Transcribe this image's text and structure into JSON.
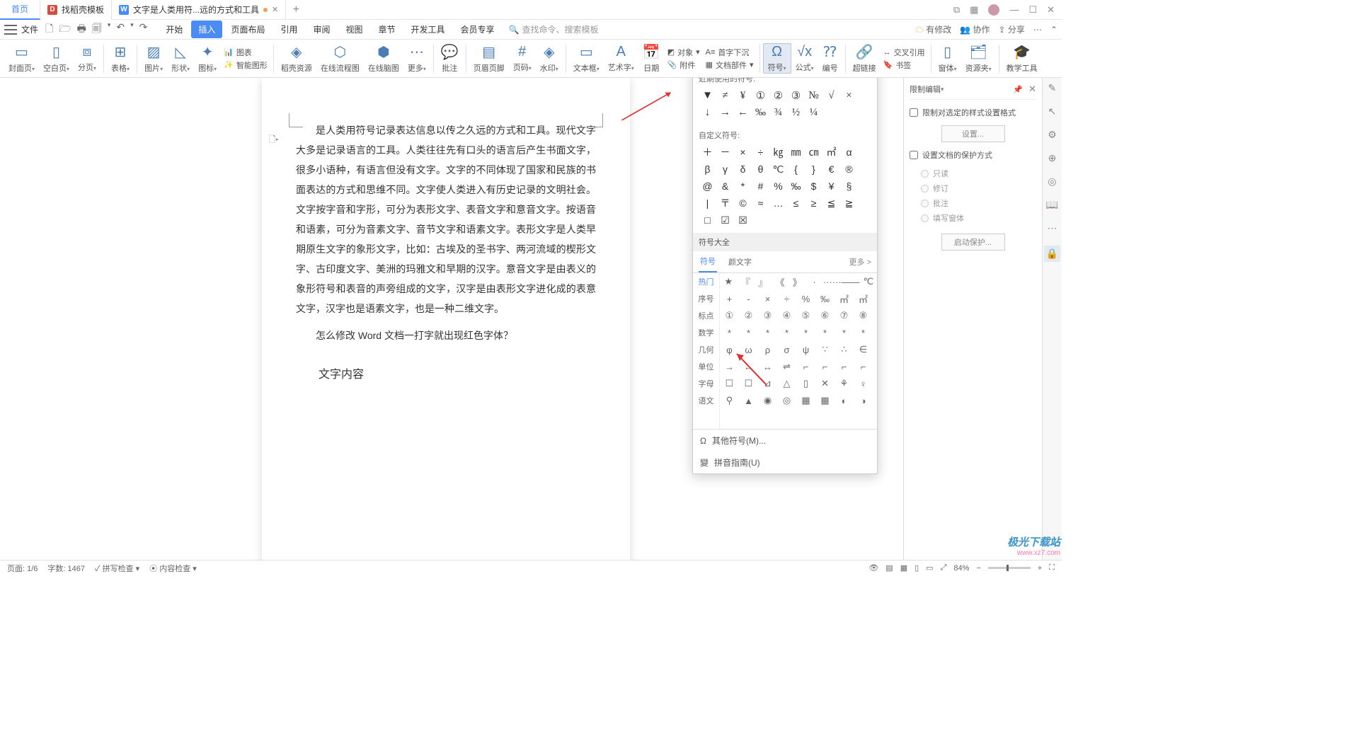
{
  "title_bar": {
    "tabs": [
      {
        "label": "首页"
      },
      {
        "label": "找稻壳模板"
      },
      {
        "label": "文字是人类用符...远的方式和工具"
      }
    ]
  },
  "menu": {
    "file": "文件",
    "tabs": [
      "开始",
      "插入",
      "页面布局",
      "引用",
      "审阅",
      "视图",
      "章节",
      "开发工具",
      "会员专享"
    ],
    "search_placeholder": "查找命令、搜索模板",
    "right": {
      "unsaved": "有修改",
      "collab": "协作",
      "share": "分享"
    }
  },
  "ribbon": {
    "items": [
      "封面页",
      "空白页",
      "分页",
      "表格",
      "图片",
      "形状",
      "图标",
      "智能图形",
      "稻壳资源",
      "在线流程图",
      "在线脑图",
      "更多",
      "批注",
      "页眉页脚",
      "页码",
      "水印",
      "文本框",
      "艺术字",
      "日期",
      "附件",
      "文档部件",
      "符号",
      "公式",
      "编号",
      "超链接",
      "书签",
      "窗体",
      "资源夹",
      "教学工具"
    ],
    "smart_label": "图表",
    "cross_ref": "交叉引用",
    "first_drop": "首字下沉",
    "attachment": "对象"
  },
  "document": {
    "p1": "是人类用符号记录表达信息以传之久远的方式和工具。现代文字大多是记录语言的工具。人类往往先有口头的语言后产生书面文字，很多小语种，有语言但没有文字。文字的不同体现了国家和民族的书面表达的方式和思维不同。文字使人类进入有历史记录的文明社会。文字按字音和字形，可分为表形文字、表音文字和意音文字。按语音和语素，可分为音素文字、音节文字和语素文字。表形文字是人类早期原生文字的象形文字，比如：古埃及的圣书字、两河流域的楔形文字、古印度文字、美洲的玛雅文和早期的汉字。意音文字是由表义的象形符号和表音的声旁组成的文字，汉字是由表形文字进化成的表意文字，汉字也是语素文字，也是一种二维文字。",
    "p2": "怎么修改 Word 文档一打字就出现红色字体？",
    "h2": "文字内容"
  },
  "symbol_panel": {
    "recent_label": "近期使用的符号:",
    "recent": [
      "▼",
      "≠",
      "¥",
      "①",
      "②",
      "③",
      "№",
      "√",
      "×",
      "↓",
      "→",
      "←",
      "‰",
      "¾",
      "½",
      "¼"
    ],
    "custom_label": "自定义符号:",
    "custom": [
      "＋",
      "－",
      "×",
      "÷",
      "㎏",
      "㎜",
      "㎝",
      "㎡",
      "α",
      "β",
      "γ",
      "δ",
      "θ",
      "℃",
      "{",
      "}",
      "€",
      "®",
      "@",
      "&",
      "*",
      "#",
      "%",
      "‰",
      "$",
      "¥",
      "§",
      "|",
      "〒",
      "©",
      "≈",
      "…",
      "≤",
      "≥",
      "≦",
      "≧",
      "□",
      "☑",
      "☒"
    ],
    "all_label": "符号大全",
    "tab1": "符号",
    "tab2": "颜文字",
    "more": "更多 >",
    "cats": [
      "热门",
      "序号",
      "标点",
      "数学",
      "几何",
      "单位",
      "字母",
      "语文"
    ],
    "grid": [
      [
        "★",
        "『",
        "』",
        "《",
        "》",
        "·",
        "······",
        "——",
        "℃"
      ],
      [
        "+",
        "-",
        "×",
        "÷",
        "%",
        "‰",
        "㎡",
        "㎡"
      ],
      [
        "①",
        "②",
        "③",
        "④",
        "⑤",
        "⑥",
        "⑦",
        "⑧"
      ],
      [
        "*",
        "*",
        "*",
        "*",
        "*",
        "*",
        "*",
        "*"
      ],
      [
        "φ",
        "ω",
        "ρ",
        "σ",
        "ψ",
        "∵",
        "∴",
        "∈"
      ],
      [
        "→",
        "←",
        "↔",
        "⇌",
        "⌐",
        "⌐",
        "⌐",
        "⌐"
      ],
      [
        "☐",
        "☐",
        "⊿",
        "△",
        "▯",
        "✕",
        "⚘",
        "♀"
      ],
      [
        "⚲",
        "▲",
        "◉",
        "◎",
        "▦",
        "▦",
        "◐",
        "◑"
      ]
    ],
    "footer1": "其他符号(M)...",
    "footer2": "拼音指南(U)"
  },
  "right_panel": {
    "title": "限制编辑",
    "chk1": "限制对选定的样式设置格式",
    "btn1": "设置...",
    "chk2": "设置文档的保护方式",
    "radios": [
      "只读",
      "修订",
      "批注",
      "填写窗体"
    ],
    "btn2": "启动保护..."
  },
  "status": {
    "page": "页面: 1/6",
    "words": "字数: 1467",
    "spell": "拼写检查",
    "content": "内容检查",
    "zoom": "84%"
  },
  "watermark": {
    "l1": "极光下载站",
    "l2": "www.xz7.com"
  }
}
